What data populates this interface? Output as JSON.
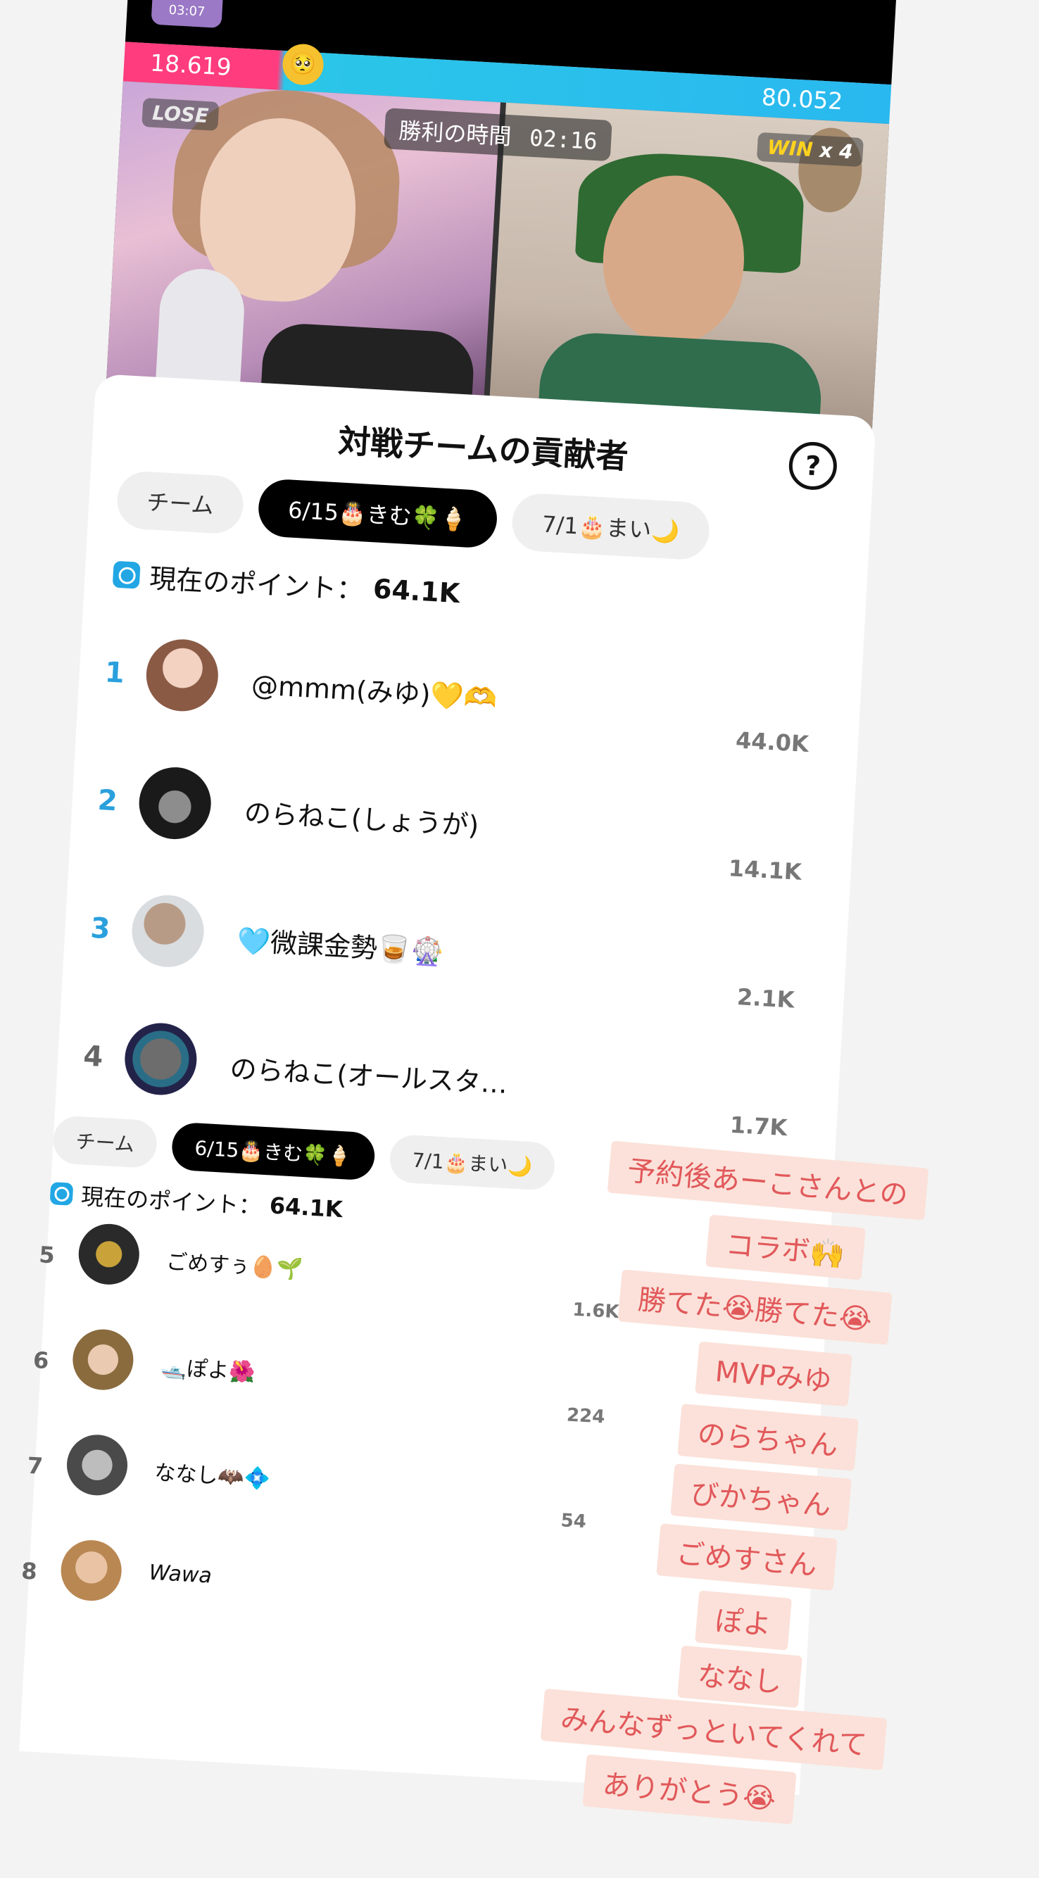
{
  "battle": {
    "timer_small": "03:07",
    "score_left": "18.619",
    "score_right": "80.052",
    "lose_label": "LOSE",
    "win_label": "WIN",
    "win_count": "x 4",
    "victory_label": "勝利の時間",
    "victory_time": "02:16",
    "colors": {
      "left": "#ff3c7d",
      "right": "#29b8ef"
    }
  },
  "sheet": {
    "title": "対戦チームの貢献者",
    "tabs": [
      {
        "label": "チーム",
        "active": false
      },
      {
        "label": "6/15🎂きむ🍀🍦",
        "active": true
      },
      {
        "label": "7/1🎂まい🌙",
        "active": false
      }
    ],
    "points_label": "現在のポイント：",
    "points_value": "64.1K",
    "ranking": [
      {
        "rank": "1",
        "name": "@mmm(みゆ)💛🫶",
        "score": "44.0K"
      },
      {
        "rank": "2",
        "name": "のらねこ(しょうが)",
        "score": "14.1K"
      },
      {
        "rank": "3",
        "name": "🩵微課金勢🥃🎡",
        "score": "2.1K"
      },
      {
        "rank": "4",
        "name": "のらねこ(オールスタ…",
        "score": "1.7K"
      }
    ]
  },
  "mini": {
    "tabs": [
      {
        "label": "チーム"
      },
      {
        "label": "6/15🎂きむ🍀🍦"
      },
      {
        "label": "7/1🎂まい🌙"
      }
    ],
    "points_label": "現在のポイント：",
    "points_value": "64.1K",
    "ranking": [
      {
        "rank": "5",
        "name": "ごめすぅ🥚🌱",
        "score": "1.6K"
      },
      {
        "rank": "6",
        "name": "🛥️ぽよ🌺",
        "score": "224"
      },
      {
        "rank": "7",
        "name": "ななし🦇💠",
        "score": "54"
      },
      {
        "rank": "8",
        "name": "Wawa",
        "score": ""
      }
    ]
  },
  "note": {
    "lines": [
      "予約後あーこさんとの",
      "コラボ🙌",
      "勝てた😭勝てた😭",
      "MVPみゆ",
      "のらちゃん",
      "びかちゃん",
      "ごめすさん",
      "ぽよ",
      "ななし",
      "みんなずっといてくれて",
      "ありがとう😭"
    ]
  }
}
